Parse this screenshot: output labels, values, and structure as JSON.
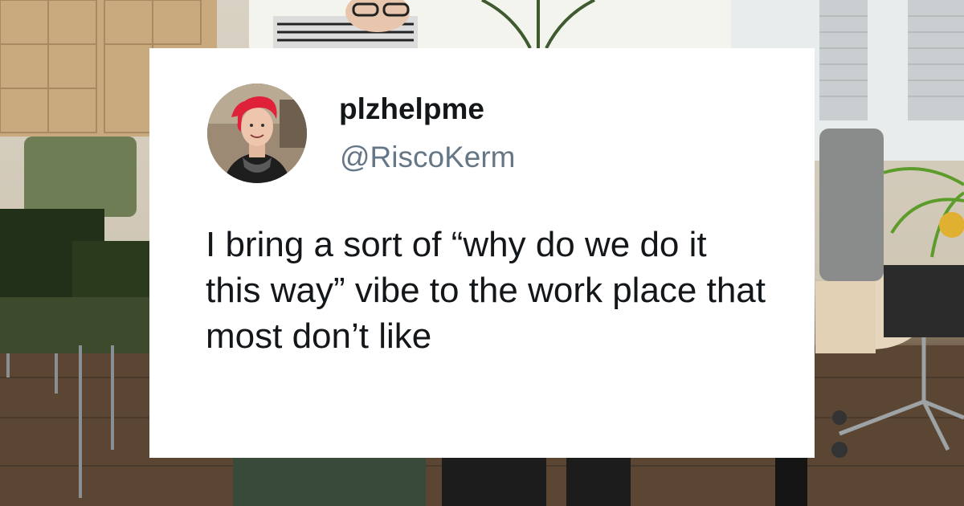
{
  "tweet": {
    "display_name": "plzhelpme",
    "handle": "@RiscoKerm",
    "text": "I bring a sort of “why do we do it this way” vibe to the work place that most don’t like"
  },
  "icons": {
    "avatar": "profile-photo",
    "background": "office-photo"
  },
  "colors": {
    "card_background": "#ffffff",
    "name_text": "#14171a",
    "handle_text": "#657786"
  }
}
